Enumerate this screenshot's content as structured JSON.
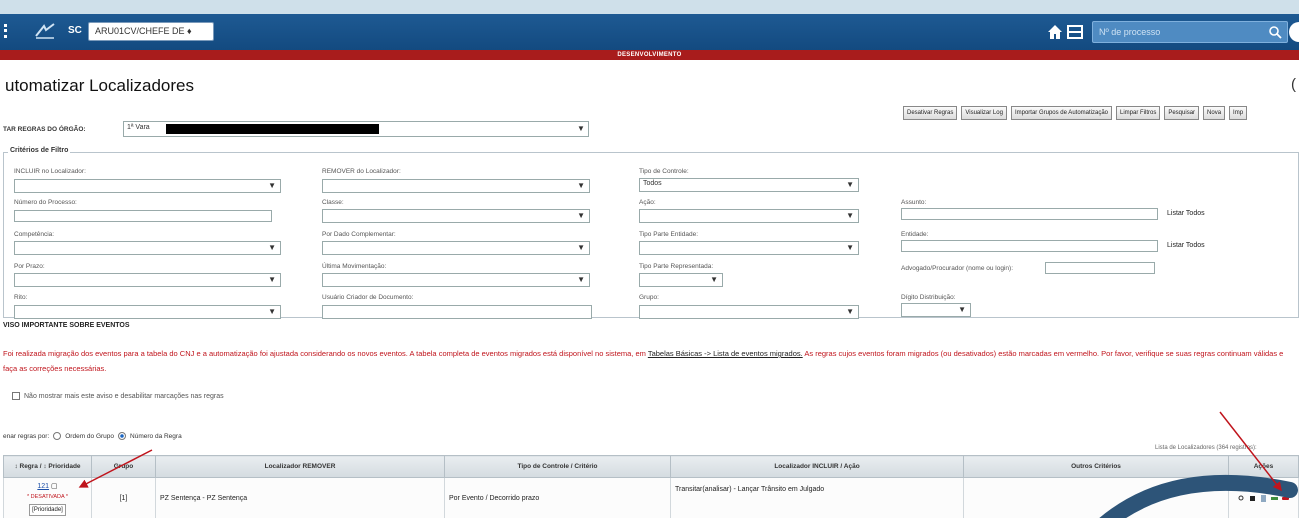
{
  "header": {
    "system_label": "SC",
    "profile": "ARU01CV/CHEFE DE ♦",
    "process_search_placeholder": "Nº de processo"
  },
  "env_banner": "DESENVOLVIMENTO",
  "page": {
    "title": "utomatizar Localizadores"
  },
  "toolbar": {
    "buttons": [
      "Desativar Regras",
      "Visualizar Log",
      "Importar Grupos de Automatização",
      "Limpar Filtros",
      "Pesquisar",
      "Nova",
      "Imp"
    ]
  },
  "org": {
    "label": "TAR REGRAS DO ÓRGÃO:",
    "value": "1ª Vara"
  },
  "filters": {
    "legend": "Critérios de Filtro",
    "fields": [
      {
        "label": "INCLUIR no Localizador:"
      },
      {
        "label": "REMOVER do Localizador:"
      },
      {
        "label": "Tipo de Controle:",
        "value": "Todos"
      },
      {
        "label": "Número do Processo:"
      },
      {
        "label": "Classe:"
      },
      {
        "label": "Ação:"
      },
      {
        "label": "Assunto:"
      },
      {
        "label": "Competência:"
      },
      {
        "label": "Por Dado Complementar:"
      },
      {
        "label": "Tipo Parte Entidade:"
      },
      {
        "label": "Entidade:"
      },
      {
        "label": "Por Prazo:"
      },
      {
        "label": "Última Movimentação:"
      },
      {
        "label": "Tipo Parte Representada:"
      },
      {
        "label": "Advogado/Procurador (nome ou login):"
      },
      {
        "label": "Rito:"
      },
      {
        "label": "Usuário Criador de Documento:"
      },
      {
        "label": "Grupo:"
      },
      {
        "label": "Dígito Distribuição:"
      }
    ],
    "list_all": "Listar Todos"
  },
  "notice": {
    "title": "VISO IMPORTANTE SOBRE EVENTOS",
    "text1": "Foi realizada migração dos eventos para a tabela do CNJ e a automatização foi ajustada considerando os novos eventos. A tabela completa de eventos migrados está disponível no sistema, em ",
    "link": "Tabelas Básicas -> Lista de eventos migrados.",
    "text2": " As regras cujos eventos foram migrados (ou desativados) estão marcadas em vermelho. Por favor, verifique se suas regras continuam válidas e faça as correções necessárias.",
    "checkbox_label": "Não mostrar mais este aviso e desabilitar marcações nas regras"
  },
  "order": {
    "label": "enar regras por:",
    "options": [
      "Ordem do Grupo",
      "Número da Regra"
    ],
    "selected": "Número da Regra"
  },
  "list_count": "Lista de Localizadores (364 registros):",
  "table": {
    "headers": [
      "↕ Regra / ↕ Prioridade",
      "Grupo",
      "Localizador REMOVER",
      "Tipo de Controle / Critério",
      "Localizador INCLUIR / Ação",
      "Outros Critérios",
      "Ações"
    ],
    "rows": [
      {
        "rule": "121",
        "status": "* DESATIVADA *",
        "priority": "[Prioridade]",
        "group": "[1]",
        "remove": "PZ Sentença - PZ Sentença",
        "control": "Por Evento / Decorrido prazo",
        "include": "Transitar(analisar) - Lançar Trânsito em Julgado",
        "other": ""
      }
    ]
  },
  "colors": {
    "header_blue": "#1e5a93",
    "env_red": "#a81c1c",
    "alert_red": "#c0141c"
  }
}
